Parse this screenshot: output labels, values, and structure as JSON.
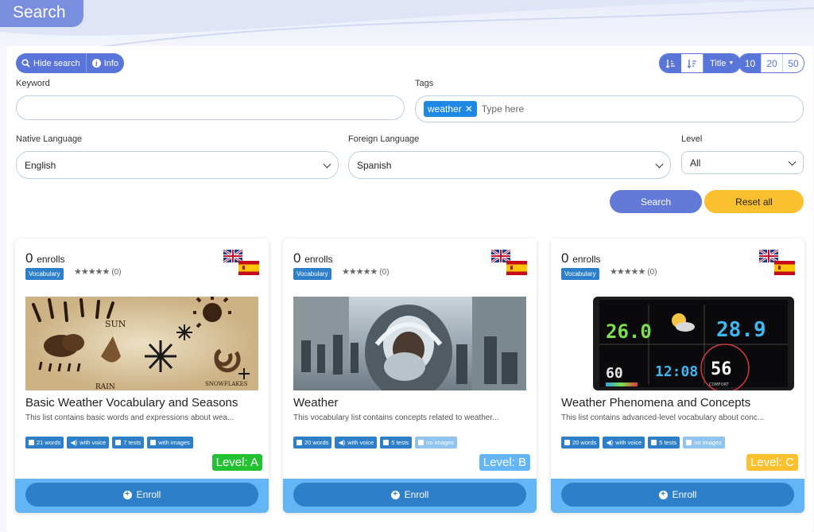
{
  "page": {
    "title": "Search"
  },
  "toolbar": {
    "hide_search": "Hide search",
    "info": "Info",
    "sort_field": "Title",
    "page_sizes": [
      "10",
      "20",
      "50"
    ]
  },
  "filters": {
    "keyword_label": "Keyword",
    "keyword_value": "",
    "tags_label": "Tags",
    "tags": [
      "weather"
    ],
    "tags_placeholder": "Type here",
    "native_label": "Native Language",
    "native_value": "English",
    "foreign_label": "Foreign Language",
    "foreign_value": "Spanish",
    "level_label": "Level",
    "level_value": "All"
  },
  "buttons": {
    "search": "Search",
    "reset": "Reset all"
  },
  "cards": [
    {
      "enroll_count": "0",
      "enroll_word": "enrolls",
      "category": "Vocabulary",
      "rating_count": "(0)",
      "title": "Basic Weather Vocabulary and Seasons",
      "description": "This list contains basic words and expressions about wea...",
      "words": "21 words",
      "voice": "with voice",
      "tests": "7 tests",
      "images": "with images",
      "images_available": true,
      "level": "Level: A",
      "level_color": "#22c232",
      "enroll_label": "Enroll",
      "thumb_text": [
        "SUN",
        "RAIN",
        "SNOWFLAKES"
      ]
    },
    {
      "enroll_count": "0",
      "enroll_word": "enrolls",
      "category": "Vocabulary",
      "rating_count": "(0)",
      "title": "Weather",
      "description": "This vocabulary list contains concepts related to weather...",
      "words": "20 words",
      "voice": "with voice",
      "tests": "5 tests",
      "images": "no images",
      "images_available": false,
      "level": "Level: B",
      "level_color": "#64b5f6",
      "enroll_label": "Enroll"
    },
    {
      "enroll_count": "0",
      "enroll_word": "enrolls",
      "category": "Vocabulary",
      "rating_count": "(0)",
      "title": "Weather Phenomena and Concepts",
      "description": "This list contains advanced-level vocabulary about conc...",
      "words": "20 words",
      "voice": "with voice",
      "tests": "5 tests",
      "images": "no images",
      "images_available": false,
      "level": "Level: C",
      "level_color": "#fbc02d",
      "enroll_label": "Enroll",
      "thumb_text": [
        "26.0",
        "28.9",
        "56",
        "12:08",
        "COMFORT"
      ]
    }
  ]
}
